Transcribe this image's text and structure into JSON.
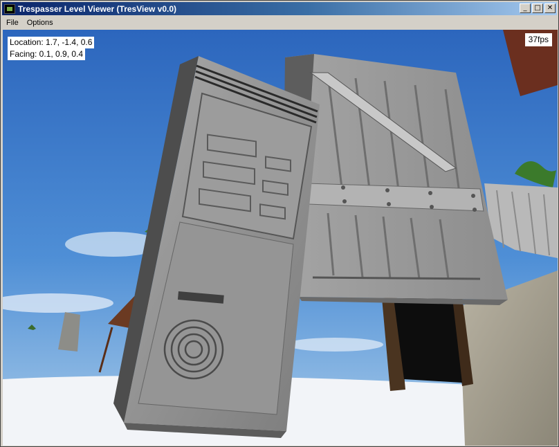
{
  "window": {
    "title": "Trespasser Level Viewer (TresView v0.0)",
    "buttons": {
      "minimize": "_",
      "maximize": "□",
      "close": "✕"
    }
  },
  "menu": [
    "File",
    "Options"
  ],
  "hud": {
    "location": "Location: 1.7, -1.4, 0.6",
    "facing": "Facing: 0.1, 0.9, 0.4",
    "fps": "37fps"
  },
  "colors": {
    "sky_top": "#2f6fc4",
    "sky_bottom": "#9cc2e6",
    "ground": "#f4f6fa",
    "crate": "#9a9a9a",
    "computer_case": "#8c8c8c"
  }
}
